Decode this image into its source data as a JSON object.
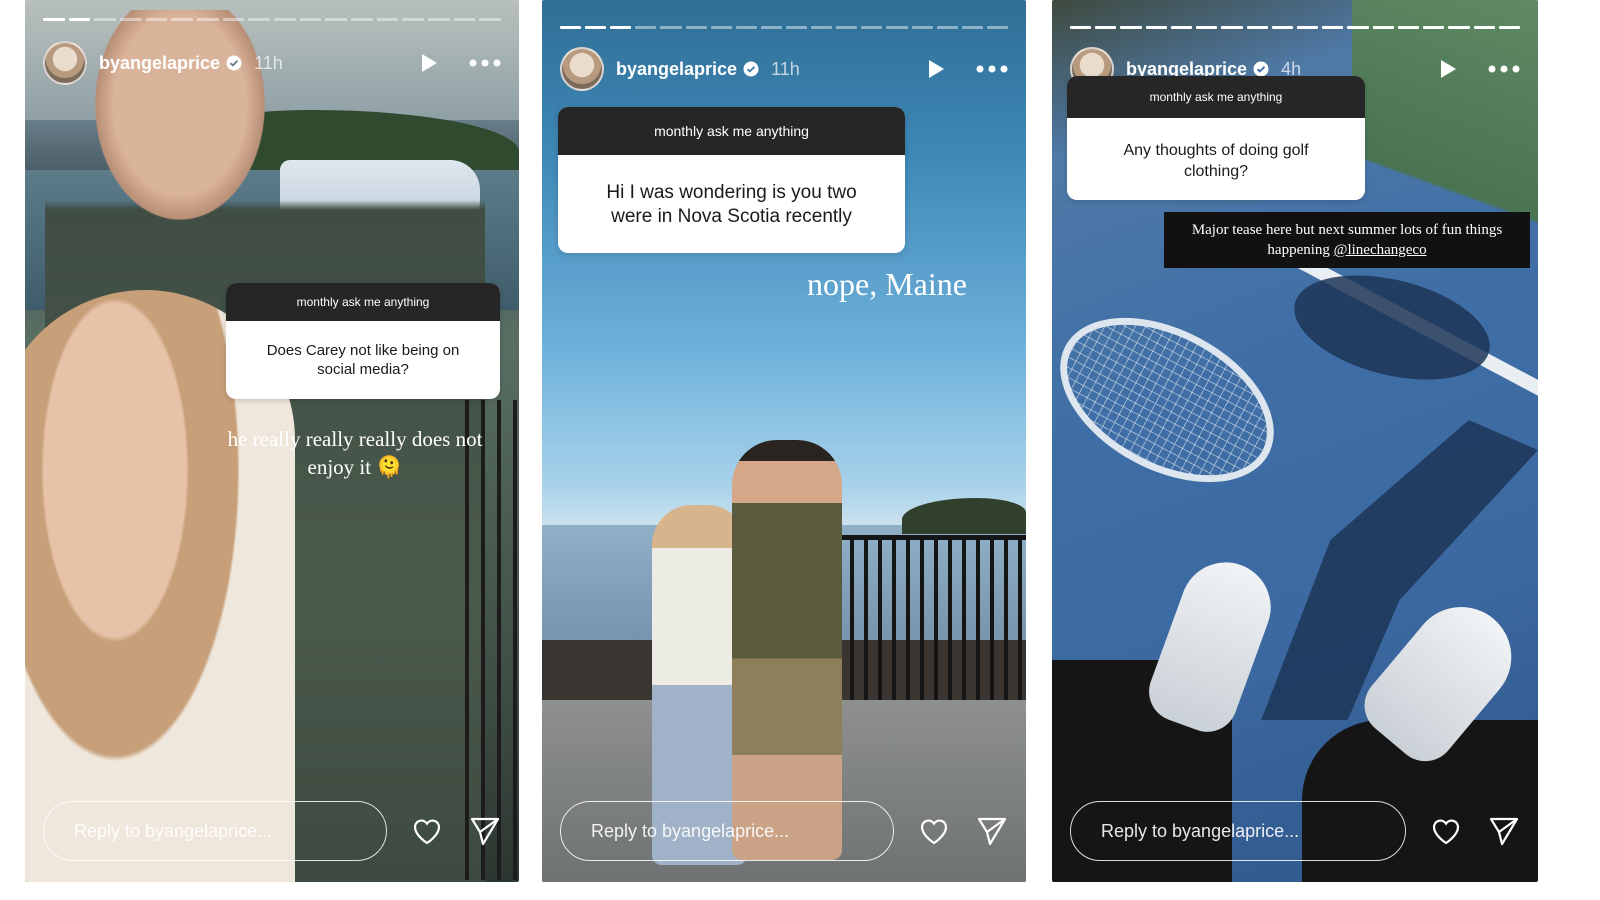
{
  "stories": [
    {
      "username": "byangelaprice",
      "time": "11h",
      "progress_done": 2,
      "progress_total": 18,
      "question_header": "monthly ask me anything",
      "question": "Does Carey not like being on social media?",
      "caption": "he really really really does not enjoy it 🫠",
      "reply_placeholder": "Reply to byangelaprice..."
    },
    {
      "username": "byangelaprice",
      "time": "11h",
      "progress_done": 3,
      "progress_total": 18,
      "question_header": "monthly ask me anything",
      "question": "Hi I was wondering is you two were in Nova Scotia recently",
      "caption": "nope, Maine",
      "reply_placeholder": "Reply to byangelaprice..."
    },
    {
      "username": "byangelaprice",
      "time": "4h",
      "progress_done": 18,
      "progress_total": 18,
      "question_header": "monthly ask me anything",
      "question": "Any thoughts of doing golf clothing?",
      "caption_prefix": "Major tease here but next summer lots of fun things happening ",
      "caption_link": "@linechangeco",
      "reply_placeholder": "Reply to byangelaprice..."
    }
  ],
  "icons": {
    "verified": "verified-badge-icon",
    "play": "play-icon",
    "more": "more-options-icon",
    "like": "heart-icon",
    "share": "send-icon"
  },
  "colors": {
    "question_header_bg": "#262626",
    "verified_blue": "#ffffff"
  }
}
